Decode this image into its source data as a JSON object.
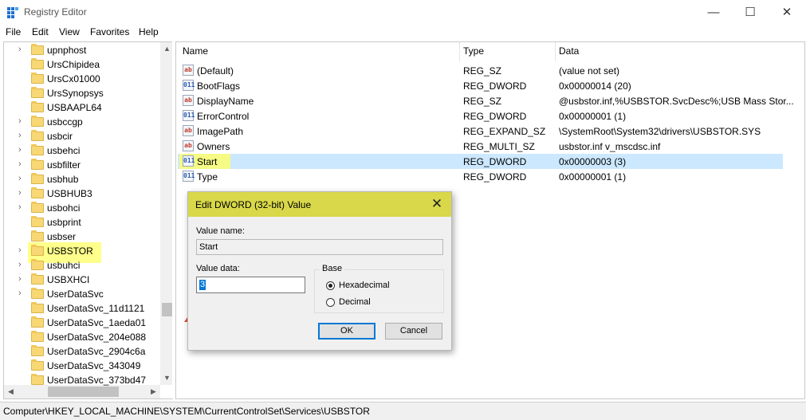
{
  "window": {
    "title": "Registry Editor",
    "minimize": "—",
    "maximize": "☐",
    "close": "✕"
  },
  "menu": [
    "File",
    "Edit",
    "View",
    "Favorites",
    "Help"
  ],
  "tree": {
    "items": [
      {
        "label": "upnphost",
        "expandable": true
      },
      {
        "label": "UrsChipidea",
        "expandable": false
      },
      {
        "label": "UrsCx01000",
        "expandable": false
      },
      {
        "label": "UrsSynopsys",
        "expandable": false
      },
      {
        "label": "USBAAPL64",
        "expandable": false
      },
      {
        "label": "usbccgp",
        "expandable": true
      },
      {
        "label": "usbcir",
        "expandable": true
      },
      {
        "label": "usbehci",
        "expandable": true
      },
      {
        "label": "usbfilter",
        "expandable": true
      },
      {
        "label": "usbhub",
        "expandable": true
      },
      {
        "label": "USBHUB3",
        "expandable": true
      },
      {
        "label": "usbohci",
        "expandable": true
      },
      {
        "label": "usbprint",
        "expandable": false
      },
      {
        "label": "usbser",
        "expandable": false
      },
      {
        "label": "USBSTOR",
        "expandable": true,
        "highlighted": true
      },
      {
        "label": "usbuhci",
        "expandable": true
      },
      {
        "label": "USBXHCI",
        "expandable": true
      },
      {
        "label": "UserDataSvc",
        "expandable": true
      },
      {
        "label": "UserDataSvc_11d1121",
        "expandable": false
      },
      {
        "label": "UserDataSvc_1aeda01",
        "expandable": false
      },
      {
        "label": "UserDataSvc_204e088",
        "expandable": false
      },
      {
        "label": "UserDataSvc_2904c6a",
        "expandable": false
      },
      {
        "label": "UserDataSvc_343049",
        "expandable": false
      },
      {
        "label": "UserDataSvc_373bd47",
        "expandable": false
      }
    ]
  },
  "list": {
    "columns": {
      "name": "Name",
      "type": "Type",
      "data": "Data"
    },
    "rows": [
      {
        "icon": "string-value-icon",
        "glyph": "ab",
        "name": "(Default)",
        "type": "REG_SZ",
        "data": "(value not set)"
      },
      {
        "icon": "dword-value-icon",
        "glyph": "011",
        "name": "BootFlags",
        "type": "REG_DWORD",
        "data": "0x00000014 (20)"
      },
      {
        "icon": "string-value-icon",
        "glyph": "ab",
        "name": "DisplayName",
        "type": "REG_SZ",
        "data": "@usbstor.inf,%USBSTOR.SvcDesc%;USB Mass Stor..."
      },
      {
        "icon": "dword-value-icon",
        "glyph": "011",
        "name": "ErrorControl",
        "type": "REG_DWORD",
        "data": "0x00000001 (1)"
      },
      {
        "icon": "string-value-icon",
        "glyph": "ab",
        "name": "ImagePath",
        "type": "REG_EXPAND_SZ",
        "data": "\\SystemRoot\\System32\\drivers\\USBSTOR.SYS"
      },
      {
        "icon": "string-value-icon",
        "glyph": "ab",
        "name": "Owners",
        "type": "REG_MULTI_SZ",
        "data": "usbstor.inf v_mscdsc.inf"
      },
      {
        "icon": "dword-value-icon",
        "glyph": "011",
        "name": "Start",
        "type": "REG_DWORD",
        "data": "0x00000003 (3)",
        "selected": true
      },
      {
        "icon": "dword-value-icon",
        "glyph": "011",
        "name": "Type",
        "type": "REG_DWORD",
        "data": "0x00000001 (1)"
      }
    ]
  },
  "status": {
    "path": "Computer\\HKEY_LOCAL_MACHINE\\SYSTEM\\CurrentControlSet\\Services\\USBSTOR"
  },
  "dialog": {
    "title": "Edit DWORD (32-bit) Value",
    "close": "✕",
    "value_name_label": "Value name:",
    "value_name": "Start",
    "value_data_label": "Value data:",
    "value_data": "3",
    "base_label": "Base",
    "hex_label": "Hexadecimal",
    "dec_label": "Decimal",
    "base_selected": "Hexadecimal",
    "ok": "OK",
    "cancel": "Cancel"
  },
  "colors": {
    "highlight": "#ffff66",
    "dialog_title": "#d8d84a",
    "selection": "#cce8ff",
    "arrow": "#e74c3c",
    "accent": "#0078d7"
  }
}
